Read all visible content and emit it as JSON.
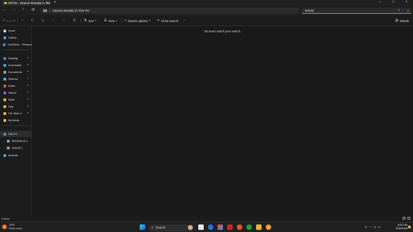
{
  "window": {
    "tab_title": "GPOS - Search Results in This P",
    "tab_close": "×",
    "new_tab": "+",
    "controls": {
      "minimize": "–",
      "maximize": "□",
      "close": "×"
    }
  },
  "nav": {
    "back": "←",
    "forward": "→",
    "up": "↑",
    "refresh": "⟳",
    "breadcrumb_chevron": "›",
    "address": "Search Results in This PC",
    "search_value": "GPOS",
    "search_clear": "×",
    "search_icon": "⌕"
  },
  "toolbar": {
    "new": "New",
    "sort": "Sort",
    "view": "View",
    "search_options": "Search options",
    "close_search": "Close search",
    "more": "···",
    "details": "Details"
  },
  "sidebar": {
    "items": [
      {
        "label": "Home",
        "icon": "home-icon",
        "color": "#cfcfcf"
      },
      {
        "label": "Gallery",
        "icon": "gallery-icon",
        "color": "#4aa3df"
      },
      {
        "label": "OneDrive - Persona",
        "icon": "onedrive-icon",
        "color": "#2b88d8"
      },
      {
        "label": "Desktop",
        "icon": "desktop-icon",
        "color": "#3b8fd9"
      },
      {
        "label": "Downloads",
        "icon": "downloads-icon",
        "color": "#3aa0e0"
      },
      {
        "label": "Documents",
        "icon": "documents-icon",
        "color": "#8fa3b8"
      },
      {
        "label": "Pictures",
        "icon": "pictures-icon",
        "color": "#4db2e6"
      },
      {
        "label": "Music",
        "icon": "music-icon",
        "color": "#e0573c"
      },
      {
        "label": "Videos",
        "icon": "videos-icon",
        "color": "#8a5cd6"
      },
      {
        "label": "Mods",
        "icon": "folder-icon",
        "color": "#e8b23c"
      },
      {
        "label": "Tray",
        "icon": "folder-icon",
        "color": "#e8b23c"
      },
      {
        "label": "The Sims 4",
        "icon": "folder-icon",
        "color": "#e8b23c"
      },
      {
        "label": "My Mods",
        "icon": "folder-icon",
        "color": "#e8b23c"
      },
      {
        "label": "This PC",
        "icon": "this-pc-icon",
        "color": "#3b8fd9"
      },
      {
        "label": "Windows (C:)",
        "icon": "drive-icon",
        "color": "#7aa6cf"
      },
      {
        "label": "Data (D:)",
        "icon": "drive-icon",
        "color": "#9a9a9a"
      },
      {
        "label": "Network",
        "icon": "network-icon",
        "color": "#4aa3df"
      }
    ],
    "pin_glyph": "✦",
    "expand_glyph": "›"
  },
  "main": {
    "empty_message": "No items match your search."
  },
  "status": {
    "item_count": "0 items"
  },
  "taskbar": {
    "weather_temp": "79°F",
    "weather_condition": "Partly sunny",
    "search_label": "Search",
    "clock_time": "8:34 PM",
    "clock_date": "3/15/2025",
    "tray_chevron": "∧"
  }
}
